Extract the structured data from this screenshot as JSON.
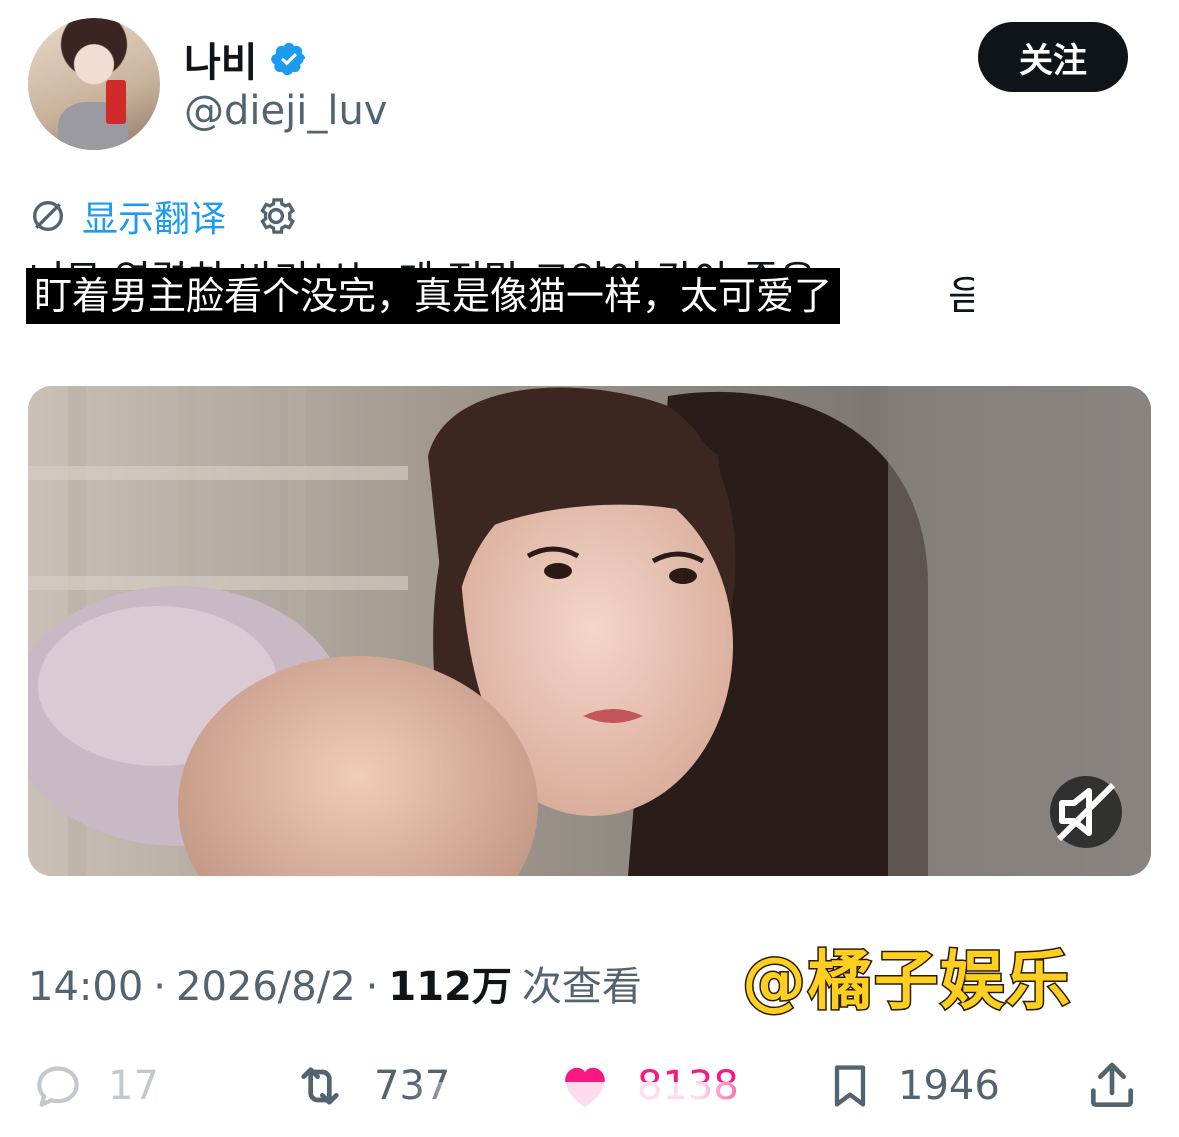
{
  "profile": {
    "display_name": "나비",
    "handle": "@dieji_luv",
    "verified": true,
    "follow_label": "关注"
  },
  "tweet": {
    "translate_label": "显示翻译",
    "caption_overlay": "盯着男主脸看个没完，真是像猫一样，太可爱了",
    "partial_korean_line": "너무 열렬히 바라보는 게 정말 고양이 같아 좋음"
  },
  "meta": {
    "time": "14:00",
    "separator": "·",
    "date": "2026/8/2",
    "views_count": "112万",
    "views_label": "次查看"
  },
  "watermark": "@橘子娱乐",
  "actions": {
    "reply_count": "17",
    "retweet_count": "737",
    "like_count": "8138",
    "bookmark_count": "1946"
  },
  "colors": {
    "accent_blue": "#1d9bf0",
    "like_pink": "#f91880",
    "text_primary": "#0f1419",
    "text_secondary": "#536471",
    "watermark_yellow": "#ffcf1f"
  },
  "icons": [
    "verified-badge-icon",
    "translate-globe-icon",
    "gear-icon",
    "mute-icon",
    "reply-icon",
    "retweet-icon",
    "like-heart-icon",
    "bookmark-icon",
    "share-icon"
  ]
}
